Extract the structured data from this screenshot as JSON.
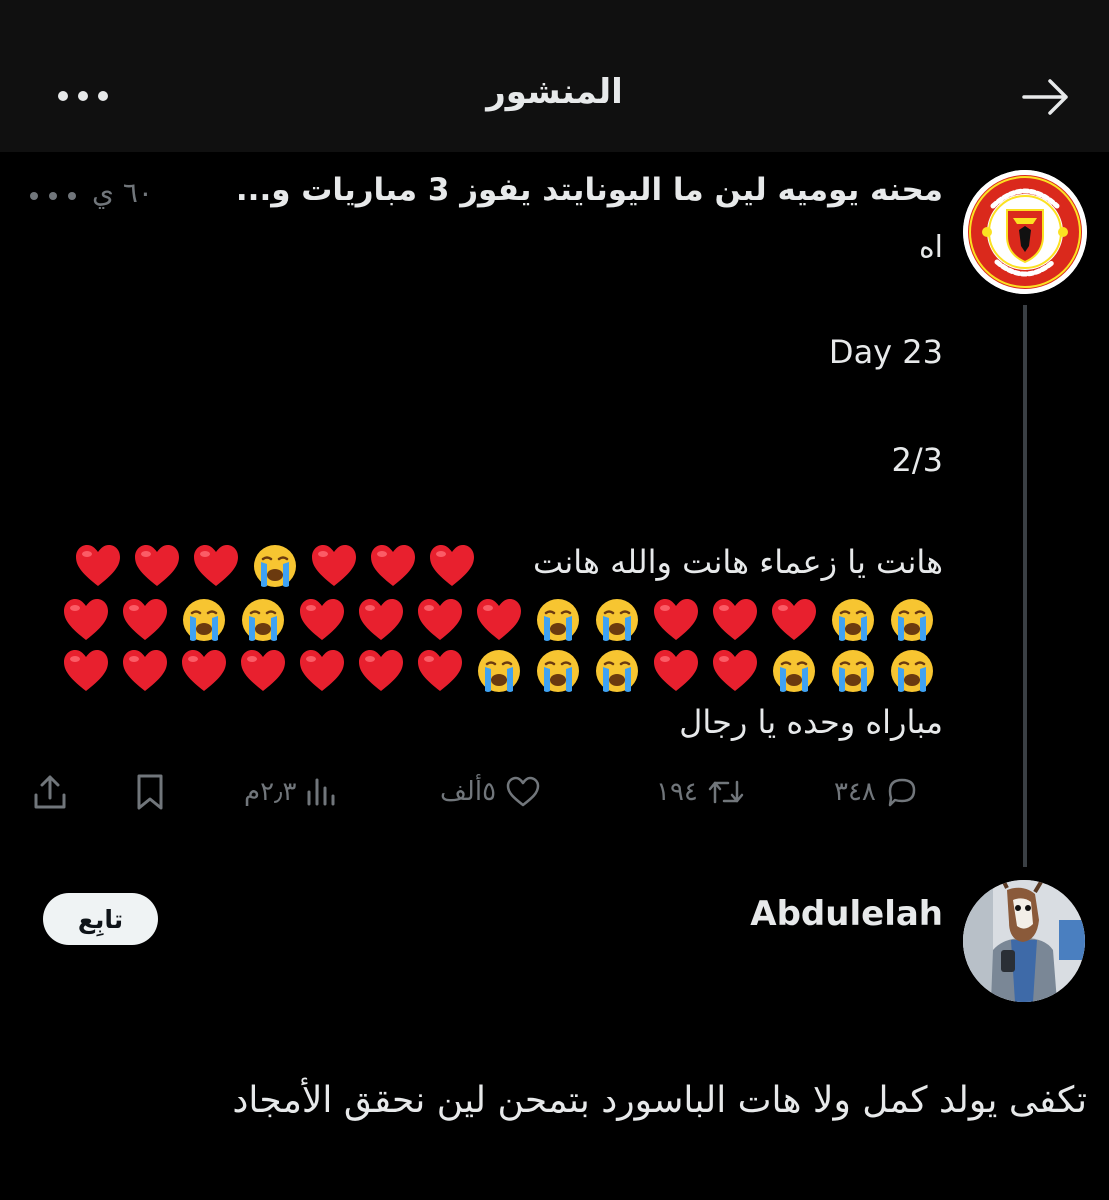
{
  "header": {
    "title": "المنشور"
  },
  "post": {
    "author_line": "محنه يوميه لين ما اليونايتد يفوز 3 مباريات و...",
    "meta": "٦٠ ي",
    "author_line_end": "اه",
    "lines": [
      "Day 23",
      "2/3",
      "هانت يا زعماء هانت والله هانت",
      "مباراه وحده يا رجال"
    ],
    "emoji_rows": [
      [
        "heart",
        "heart",
        "heart",
        "sob",
        "heart",
        "heart",
        "heart"
      ],
      [
        "sob",
        "sob",
        "heart",
        "heart",
        "heart",
        "sob",
        "sob",
        "heart",
        "heart",
        "heart",
        "heart",
        "sob",
        "sob",
        "heart",
        "heart"
      ],
      [
        "sob",
        "sob",
        "sob",
        "heart",
        "heart",
        "sob",
        "sob",
        "sob",
        "heart",
        "heart",
        "heart",
        "heart",
        "heart",
        "heart",
        "heart"
      ]
    ],
    "stats": {
      "replies": "٣٤٨",
      "reposts": "١٩٤",
      "likes": "٥ألف",
      "views": "٢٫٣م"
    },
    "icons": {
      "back": "arrow-right-icon",
      "more": "more-dots-icon",
      "reply": "reply-bubble-icon",
      "repost": "repost-icon",
      "like": "heart-outline-icon",
      "views": "views-bars-icon",
      "bookmark": "bookmark-icon",
      "share": "share-icon"
    }
  },
  "reply": {
    "name": "Abdulelah",
    "follow_label": "تابِع",
    "text": "تكفى يولد كمل ولا هات الباسورد بتمحن لين نحقق الأمجاد"
  },
  "colors": {
    "background": "#000000",
    "header": "#101010",
    "text": "#e7e9ea",
    "muted": "#71767b",
    "united_red": "#da291c",
    "united_gold": "#fbe122"
  }
}
